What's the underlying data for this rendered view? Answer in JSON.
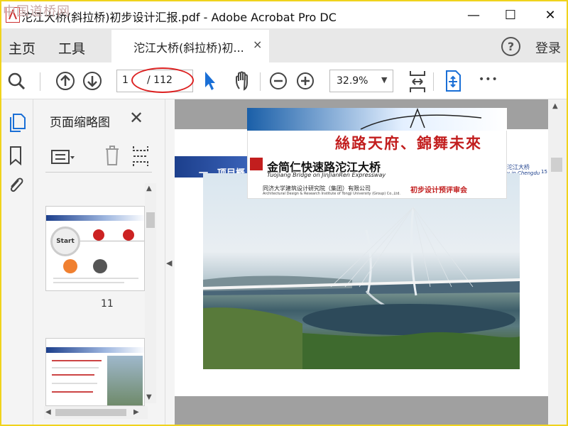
{
  "window": {
    "title": "沱江大桥(斜拉桥)初步设计汇报.pdf - Adobe Acrobat Pro DC",
    "watermark": "中国道桥网",
    "minimize": "—",
    "maximize": "☐",
    "close": "✕"
  },
  "nav": {
    "home": "主页",
    "tools": "工具",
    "doc_tab": "沱江大桥(斜拉桥)初...",
    "doc_tab_close": "×",
    "help": "?",
    "login": "登录"
  },
  "toolbar": {
    "page_current": "1",
    "page_total": "/ 112",
    "zoom": "32.9%",
    "more": "•••"
  },
  "thumbnails": {
    "title": "页面缩略图",
    "close": "✕",
    "page_label": "11"
  },
  "thumb11": {
    "start": "Start"
  },
  "slide": {
    "section": "一、项目概",
    "slogan": "絲路天府、錦舞未來",
    "bridge_title": "金简仁快速路沱江大桥",
    "bridge_sub": "Tuojiang Bridge on JinJianRen Expressway",
    "institute": "同济大学建筑设计研究院（集团）有限公司",
    "institute_en": "Architectural Design & Research Institute of Tongji University (Group) Co.,Ltd.",
    "review": "初步设计预评审会",
    "corner_title": "沱江大桥",
    "corner_sub": "y in Chengdu",
    "corner_num": "15"
  },
  "colors": {
    "accent_blue": "#1c3f8c",
    "slogan_red": "#c21e1e",
    "annotation_red": "#d22222",
    "cursor_blue": "#1a6fd6"
  }
}
